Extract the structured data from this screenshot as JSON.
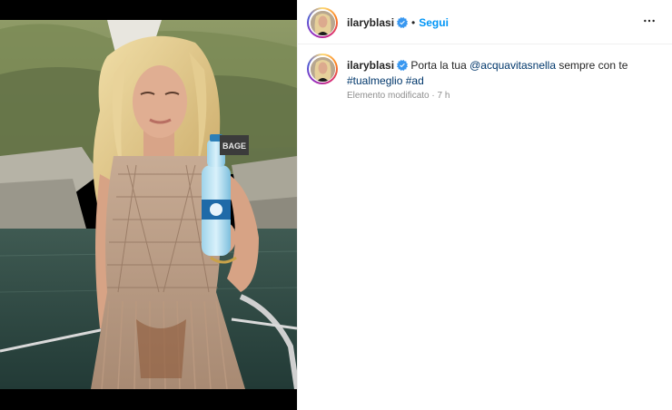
{
  "post": {
    "username": "ilaryblasi",
    "follow_label": "Segui",
    "separator": "•",
    "caption": {
      "username": "ilaryblasi",
      "text_before": "Porta la tua ",
      "mention": "@acquavitasnella",
      "text_middle": " sempre con te",
      "hashtag1": "#tualmeglio",
      "hashtag2": "#ad"
    },
    "meta": "Elemento modificato · 7 h",
    "bottle_label": "BAGE"
  },
  "icons": {
    "verified": "verified-badge-icon",
    "more": "more-options-icon"
  },
  "colors": {
    "link_blue": "#0095f6",
    "hashtag_blue": "#00376b",
    "verified_blue": "#3897f0",
    "meta_gray": "#8e8e8e"
  }
}
